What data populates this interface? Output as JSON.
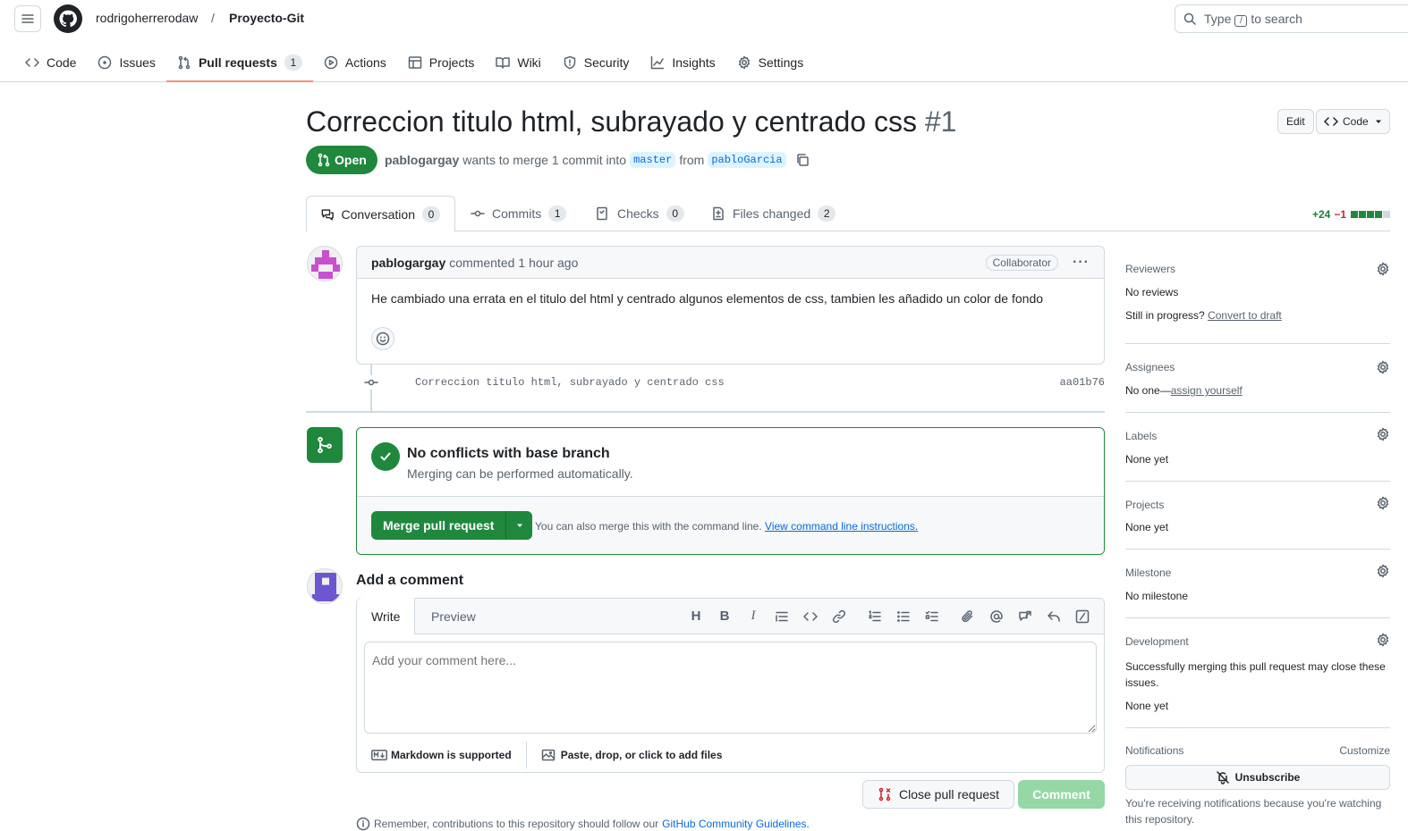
{
  "header": {
    "owner": "rodrigoherrerodaw",
    "separator": "/",
    "repo": "Proyecto-Git",
    "search_prefix": "Type",
    "search_key": "/",
    "search_suffix": "to search"
  },
  "repo_nav": [
    {
      "label": "Code",
      "icon": "code-icon"
    },
    {
      "label": "Issues",
      "icon": "issue-icon"
    },
    {
      "label": "Pull requests",
      "icon": "pull-request-icon",
      "count": "1",
      "active": true
    },
    {
      "label": "Actions",
      "icon": "play-icon"
    },
    {
      "label": "Projects",
      "icon": "table-icon"
    },
    {
      "label": "Wiki",
      "icon": "book-icon"
    },
    {
      "label": "Security",
      "icon": "shield-icon"
    },
    {
      "label": "Insights",
      "icon": "graph-icon"
    },
    {
      "label": "Settings",
      "icon": "gear-icon"
    }
  ],
  "pr": {
    "title": "Correccion titulo html, subrayado y centrado css",
    "number": "#1",
    "edit_label": "Edit",
    "code_label": "Code",
    "state": "Open",
    "author": "pablogargay",
    "meta_text": "wants to merge 1 commit into",
    "base_branch": "master",
    "from_text": "from",
    "head_branch": "pabloGarcia"
  },
  "pr_tabs": [
    {
      "label": "Conversation",
      "count": "0"
    },
    {
      "label": "Commits",
      "count": "1"
    },
    {
      "label": "Checks",
      "count": "0"
    },
    {
      "label": "Files changed",
      "count": "2"
    }
  ],
  "diffstat": {
    "additions": "+24",
    "deletions": "−1"
  },
  "comment": {
    "author": "pablogargay",
    "action": "commented",
    "time": "1 hour ago",
    "role": "Collaborator",
    "body": "He cambiado una errata en el titulo del html y centrado algunos elementos de css, tambien les añadido un color de fondo"
  },
  "commit": {
    "message": "Correccion titulo html, subrayado y centrado css",
    "sha": "aa01b76"
  },
  "merge": {
    "heading": "No conflicts with base branch",
    "subtext": "Merging can be performed automatically.",
    "button": "Merge pull request",
    "alt_text": "You can also merge this with the command line.",
    "alt_link": "View command line instructions."
  },
  "comment_form": {
    "heading": "Add a comment",
    "tab_write": "Write",
    "tab_preview": "Preview",
    "placeholder": "Add your comment here...",
    "markdown_note": "Markdown is supported",
    "attach_note": "Paste, drop, or click to add files",
    "close_button": "Close pull request",
    "comment_button": "Comment",
    "guidelines_prefix": "Remember, contributions to this repository should follow our",
    "guidelines_link": "GitHub Community Guidelines."
  },
  "sidebar": {
    "reviewers": {
      "title": "Reviewers",
      "value": "No reviews",
      "draft_prefix": "Still in progress?",
      "draft_link": "Convert to draft"
    },
    "assignees": {
      "title": "Assignees",
      "prefix": "No one—",
      "link": "assign yourself"
    },
    "labels": {
      "title": "Labels",
      "value": "None yet"
    },
    "projects": {
      "title": "Projects",
      "value": "None yet"
    },
    "milestone": {
      "title": "Milestone",
      "value": "No milestone"
    },
    "development": {
      "title": "Development",
      "note": "Successfully merging this pull request may close these issues.",
      "value": "None yet"
    },
    "notifications": {
      "title": "Notifications",
      "customize": "Customize",
      "button": "Unsubscribe",
      "note": "You're receiving notifications because you're watching this repository."
    }
  },
  "colors": {
    "accent_green": "#1f883d",
    "link_blue": "#0969da",
    "tab_underline": "#fd8c73",
    "muted": "#59636e"
  }
}
